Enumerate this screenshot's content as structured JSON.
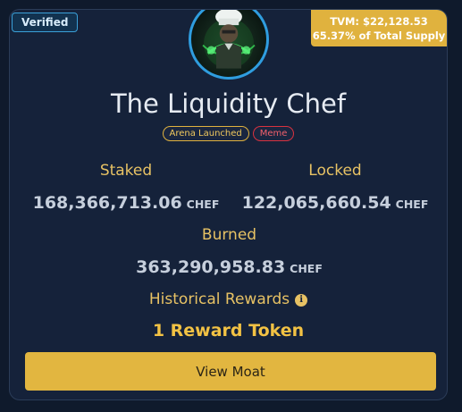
{
  "card": {
    "verified_label": "Verified",
    "tvm_line1": "TVM: $22,128.53",
    "tvm_line2": "65.37% of Total Supply",
    "title": "The Liquidity Chef",
    "badges": {
      "arena": "Arena Launched",
      "meme": "Meme"
    },
    "staked": {
      "label": "Staked",
      "value": "168,366,713.06",
      "unit": "CHEF"
    },
    "locked": {
      "label": "Locked",
      "value": "122,065,660.54",
      "unit": "CHEF"
    },
    "burned": {
      "label": "Burned",
      "value": "363,290,958.83",
      "unit": "CHEF"
    },
    "rewards": {
      "label": "Historical Rewards",
      "info_icon": "i",
      "value": "1 Reward Token"
    },
    "button_label": "View Moat"
  },
  "colors": {
    "background": "#0f1a2c",
    "card": "#15223a",
    "accent_gold": "#e2b640",
    "verified_border": "#3aa0d8",
    "meme_red": "#d9323f"
  },
  "icons": {
    "avatar": "chef-avatar",
    "info": "info-icon"
  }
}
